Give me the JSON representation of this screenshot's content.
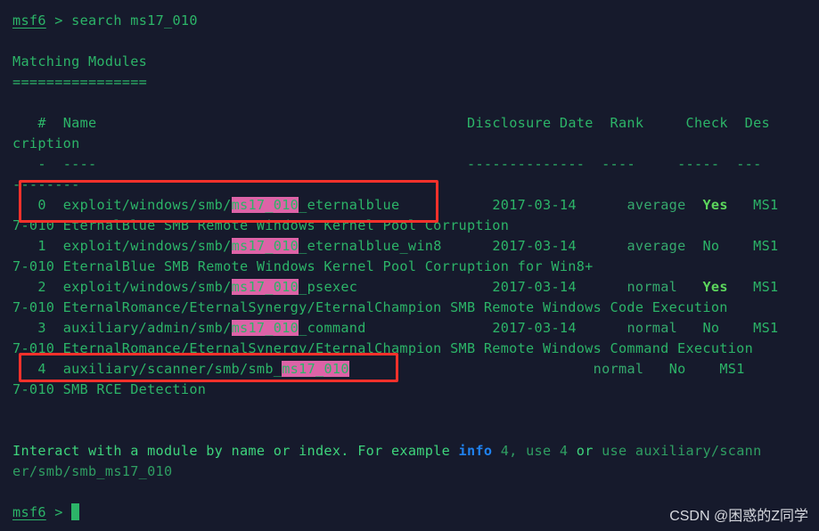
{
  "terminal": {
    "background_color": "#161a2c",
    "text_color": "#2cb468",
    "highlight_color": "#dd63a7",
    "annotation_color": "#f8312b",
    "prompt": "msf6",
    "prompt_symbol": ">",
    "command": "search ms17_010",
    "heading": "Matching Modules",
    "heading_underline": "================",
    "header": {
      "index": "#",
      "name": "Name",
      "disclosure_date": "Disclosure Date",
      "rank": "Rank",
      "check": "Check",
      "description_part1": "Des",
      "description_part2": "cription",
      "dashes_index": "-",
      "dashes_name": "----",
      "dashes_date": "--------------",
      "dashes_rank": "----",
      "dashes_check": "-----",
      "dashes_desc_part1": "---",
      "dashes_desc_part2": "--------"
    },
    "rows": [
      {
        "index": "0",
        "name_prefix": "exploit/windows/smb/",
        "name_highlight": "ms17_010",
        "name_suffix": "_eternalblue",
        "disclosure_date": "2017-03-14",
        "rank": "average",
        "check": "Yes",
        "description_head": "MS1",
        "description_tail": "7-010 EternalBlue SMB Remote Windows Kernel Pool Corruption"
      },
      {
        "index": "1",
        "name_prefix": "exploit/windows/smb/",
        "name_highlight": "ms17_010",
        "name_suffix": "_eternalblue_win8",
        "disclosure_date": "2017-03-14",
        "rank": "average",
        "check": "No",
        "description_head": "MS1",
        "description_tail": "7-010 EternalBlue SMB Remote Windows Kernel Pool Corruption for Win8+"
      },
      {
        "index": "2",
        "name_prefix": "exploit/windows/smb/",
        "name_highlight": "ms17_010",
        "name_suffix": "_psexec",
        "disclosure_date": "2017-03-14",
        "rank": "normal",
        "check": "Yes",
        "description_head": "MS1",
        "description_tail": "7-010 EternalRomance/EternalSynergy/EternalChampion SMB Remote Windows Code Execution"
      },
      {
        "index": "3",
        "name_prefix": "auxiliary/admin/smb/",
        "name_highlight": "ms17_010",
        "name_suffix": "_command",
        "disclosure_date": "2017-03-14",
        "rank": "normal",
        "check": "No",
        "description_head": "MS1",
        "description_tail": "7-010 EternalRomance/EternalSynergy/EternalChampion SMB Remote Windows Command Execution"
      },
      {
        "index": "4",
        "name_prefix": "auxiliary/scanner/smb/smb_",
        "name_highlight": "ms17_010",
        "name_suffix": "",
        "disclosure_date": "",
        "rank": "normal",
        "check": "No",
        "description_head": "MS1",
        "description_tail": "7-010 SMB RCE Detection"
      }
    ],
    "footer": {
      "part1": "Interact with a module by name or index. For example ",
      "info_cmd": "info",
      "part2": " 4, ",
      "use1": "use",
      "part3": " 4 ",
      "or": "or",
      "part4": " ",
      "use2": "use",
      "part5": " auxiliary/scann",
      "wrap": "er/smb/smb_ms17_010"
    },
    "final_prompt": "msf6",
    "final_prompt_symbol": ">",
    "watermark": "CSDN @困惑的Z同学"
  }
}
